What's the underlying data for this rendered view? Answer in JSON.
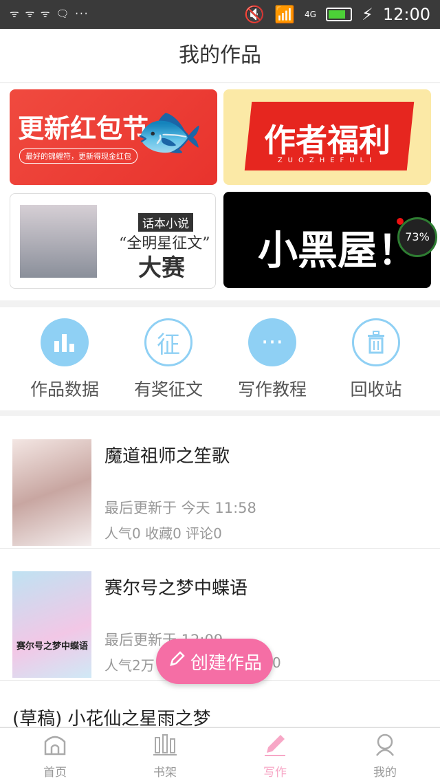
{
  "status": {
    "left": "ᯤ ᯤ ᯤ 🗨 ···",
    "signal": "4G",
    "time": "12:00"
  },
  "header": {
    "title": "我的作品"
  },
  "banners": {
    "b1_title": "更新红包节",
    "b1_sub": "最好的锦鲤符，更新得现金红包",
    "b2_title": "作者福利",
    "b2_sub": "ZUOZHEFULI",
    "b3_small": "话本小说",
    "b3_mid": "“全明星征文”",
    "b3_big": "大赛",
    "b4_title": "小黑屋！"
  },
  "overlay": {
    "percent": "73%"
  },
  "quick": [
    {
      "label": "作品数据",
      "icon": "bar-chart-icon"
    },
    {
      "label": "有奖征文",
      "icon": "contest-icon",
      "glyph": "征"
    },
    {
      "label": "写作教程",
      "icon": "chat-bubble-icon",
      "glyph": "···"
    },
    {
      "label": "回收站",
      "icon": "trash-icon"
    }
  ],
  "works": [
    {
      "title": "魔道祖师之笙歌",
      "updated": "最后更新于 今天 11:58",
      "stats": "人气0 收藏0 评论0"
    },
    {
      "title": "赛尔号之梦中蝶语",
      "updated": "最后更新于 12:09",
      "stats": "人气2万",
      "stats_tail": "0",
      "cover_text": "赛尔号之梦中蝶语"
    }
  ],
  "draft": {
    "title": "(草稿) 小花仙之星雨之梦"
  },
  "fab": {
    "label": "创建作品"
  },
  "tabs": [
    {
      "label": "首页",
      "icon": "home-icon"
    },
    {
      "label": "书架",
      "icon": "bookshelf-icon"
    },
    {
      "label": "写作",
      "icon": "pen-icon",
      "active": true
    },
    {
      "label": "我的",
      "icon": "profile-icon"
    }
  ]
}
